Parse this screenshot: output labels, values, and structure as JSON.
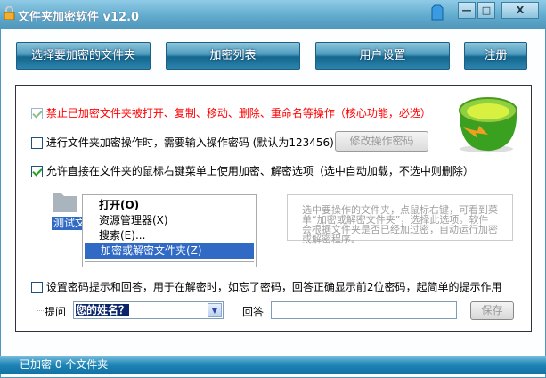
{
  "window": {
    "title": "文件夹加密软件  v12.0",
    "minimize": "—",
    "maximize": "□",
    "close": "X"
  },
  "toolbar": {
    "select_folder": "选择要加密的文件夹",
    "encrypt_list": "加密列表",
    "user_settings": "用户设置",
    "register": "注册"
  },
  "options": {
    "opt1": {
      "label": "禁止已加密文件夹被打开、复制、移动、删除、重命名等操作（核心功能，必选）",
      "checked": true,
      "color": "#ff0000"
    },
    "opt2": {
      "label": "进行文件夹加密操作时，需要输入操作密码 (默认为123456)",
      "checked": false
    },
    "change_password_button": "修改操作密码",
    "opt3": {
      "label": "允许直接在文件夹的鼠标右键菜单上使用加密、解密选项（选中自动加载，不选中则删除）",
      "checked": true
    }
  },
  "demo": {
    "folder_label": "测试文",
    "menu": [
      "打开(O)",
      "资源管理器(X)",
      "搜索(E)...",
      "加密或解密文件夹(Z)"
    ],
    "hint": "选中要操作的文件夹，点鼠标右键，可看到菜单“加密或解密文件夹”，选择此选项。软件会根据文件夹是否已经加过密，自动运行加密或解密程序。"
  },
  "password_hint": {
    "label": "设置密码提示和回答，用于在解密时，如忘了密码，回答正确显示前2位密码，起简单的提示作用",
    "checked": false,
    "question_label": "提问",
    "question_value": "您的姓名？",
    "answer_label": "回答",
    "answer_value": "",
    "save": "保存"
  },
  "status": {
    "text": "已加密 0 个文件夹"
  }
}
